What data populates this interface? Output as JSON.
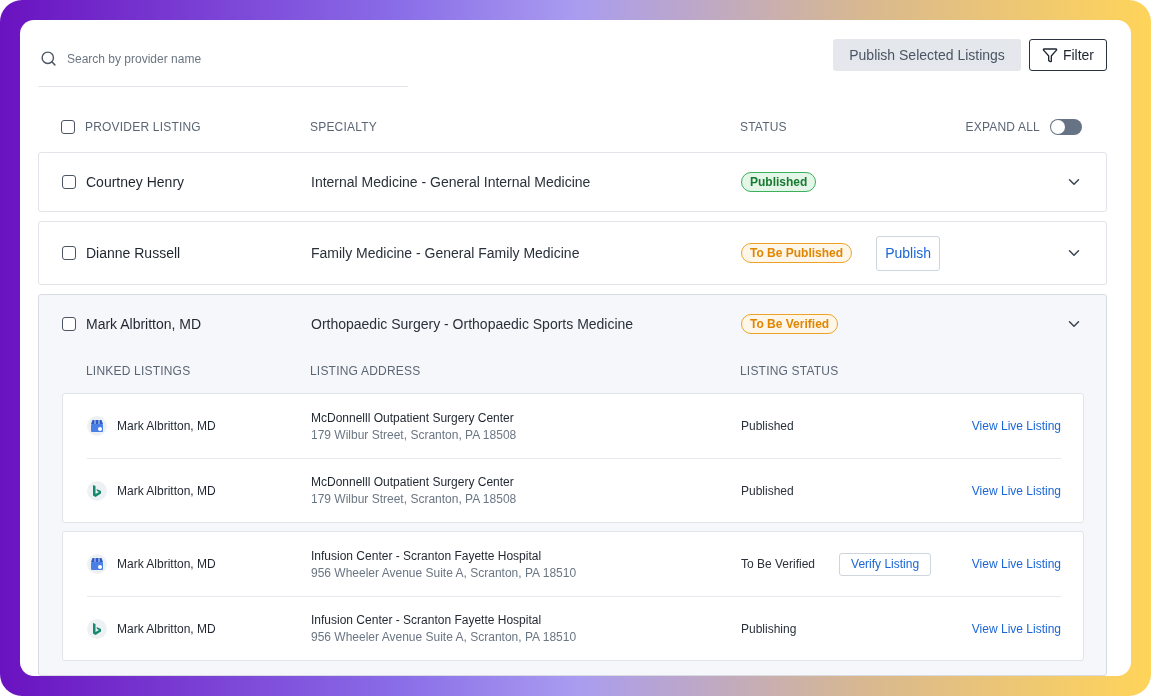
{
  "search": {
    "placeholder": "Search by provider name"
  },
  "toolbar": {
    "publish_selected": {
      "label": "Publish Selected Listings",
      "disabled": true
    },
    "filter": {
      "label": "Filter"
    }
  },
  "columns": {
    "select_all": {
      "checked": false
    },
    "labels": [
      "PROVIDER LISTING",
      "SPECIALTY",
      "STATUS"
    ],
    "expand_all": {
      "label": "EXPAND ALL",
      "on": false
    }
  },
  "providers": [
    {
      "name": "Courtney Henry",
      "checked": false,
      "specialty": "Internal Medicine - General Internal Medicine",
      "status": {
        "label": "Published",
        "kind": "published"
      }
    },
    {
      "name": "Dianne Russell",
      "checked": false,
      "specialty": "Family Medicine - General Family Medicine",
      "status": {
        "label": "To Be Published",
        "kind": "pending"
      },
      "action": "Publish"
    },
    {
      "name": "Mark Albritton, MD",
      "checked": false,
      "specialty": "Orthopaedic Surgery - Orthopaedic Sports Medicine",
      "status": {
        "label": "To Be Verified",
        "kind": "pending"
      },
      "linked": {
        "labels": [
          "LINKED LISTINGS",
          "LISTING ADDRESS",
          "LISTING STATUS"
        ],
        "groups": [
          [
            {
              "kind": "google",
              "name": "Mark Albritton, MD",
              "place": "McDonnelll Outpatient Surgery Center",
              "address": "179 Wilbur Street, Scranton, PA 18508",
              "status": "Published",
              "link": "View Live Listing"
            },
            {
              "kind": "bing",
              "name": "Mark Albritton, MD",
              "place": "McDonnelll Outpatient Surgery Center",
              "address": "179 Wilbur Street, Scranton, PA 18508",
              "status": "Published",
              "link": "View Live Listing"
            }
          ],
          [
            {
              "kind": "google",
              "name": "Mark Albritton, MD",
              "place": "Infusion Center - Scranton Fayette Hospital",
              "address": "956 Wheeler Avenue Suite A, Scranton, PA 18510",
              "status": "To Be Verified",
              "action": "Verify Listing",
              "link": "View Live Listing"
            },
            {
              "kind": "bing",
              "name": "Mark Albritton, MD",
              "place": "Infusion Center - Scranton Fayette Hospital",
              "address": "956 Wheeler Avenue Suite A, Scranton, PA 18510",
              "status": "Publishing",
              "link": "View Live Listing"
            }
          ]
        ]
      }
    }
  ]
}
